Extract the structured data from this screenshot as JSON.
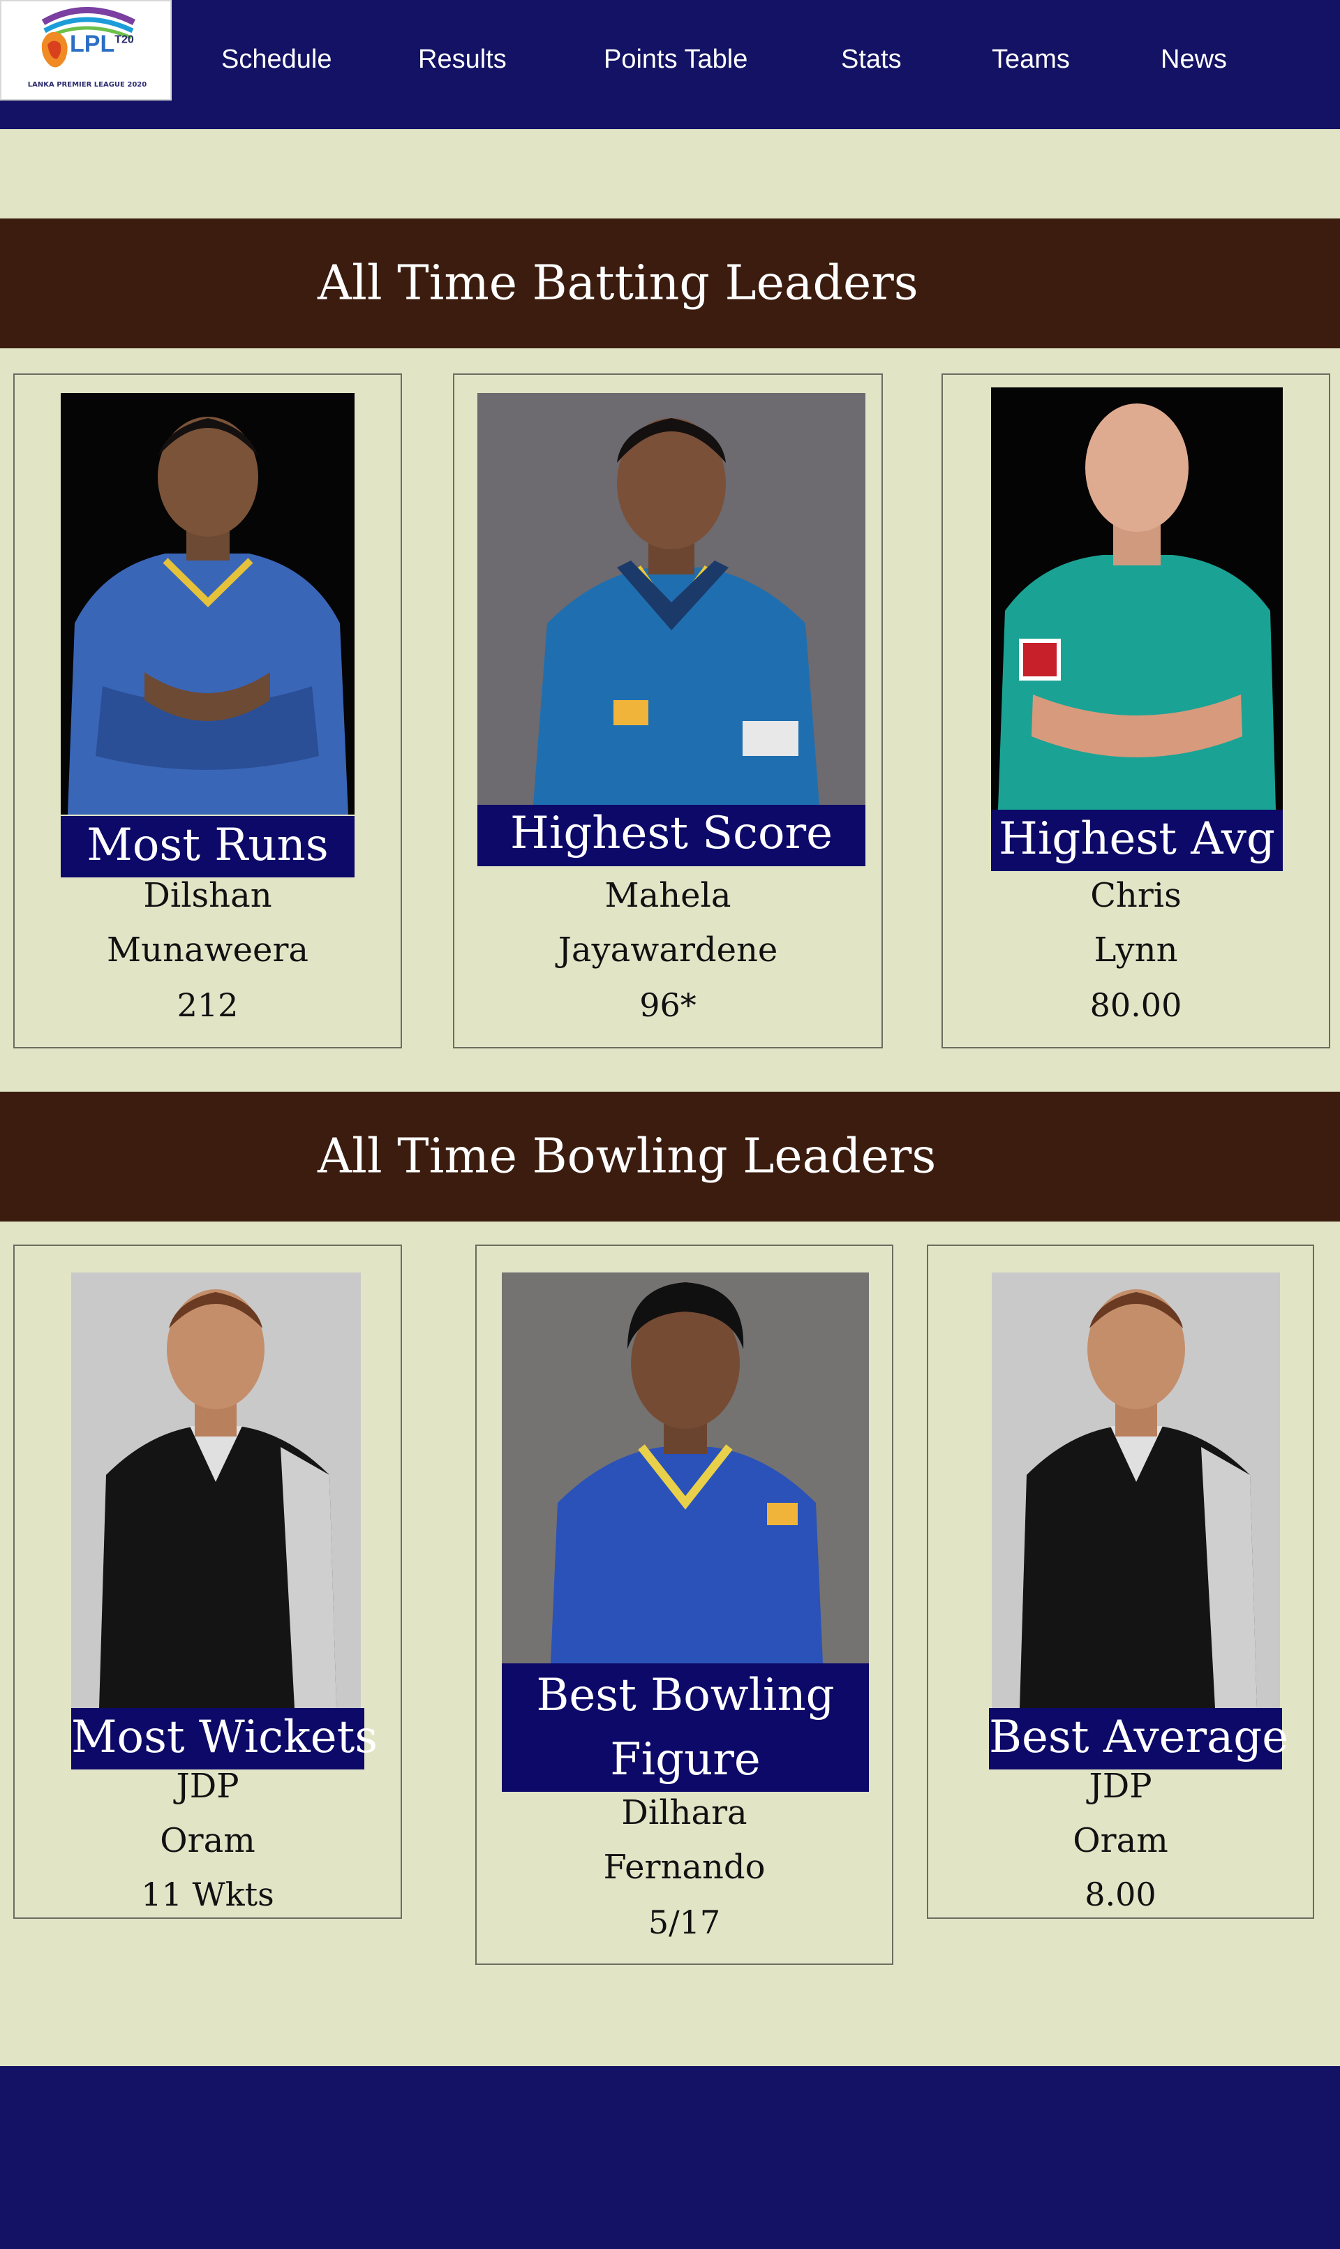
{
  "brand": {
    "logo_text": "LPL",
    "logo_superscript": "T20",
    "logo_tagline": "LANKA PREMIER LEAGUE 2020"
  },
  "nav": {
    "items": [
      "Schedule",
      "Results",
      "Points Table",
      "Stats",
      "Teams",
      "News"
    ]
  },
  "batting": {
    "title": "All Time Batting Leaders",
    "cards": [
      {
        "label": "Most Runs",
        "first_name": "Dilshan",
        "last_name": "Munaweera",
        "value": "212"
      },
      {
        "label": "Highest Score",
        "first_name": "Mahela",
        "last_name": "Jayawardene",
        "value": "96*"
      },
      {
        "label": "Highest Avg",
        "first_name": "Chris",
        "last_name": "Lynn",
        "value": "80.00"
      }
    ]
  },
  "bowling": {
    "title": "All Time Bowling Leaders",
    "cards": [
      {
        "label": "Most Wickets",
        "first_name": "JDP",
        "last_name": "Oram",
        "value": "11 Wkts"
      },
      {
        "label_line1": "Best Bowling",
        "label_line2": "Figure",
        "first_name": "Dilhara",
        "last_name": "Fernando",
        "value": "5/17"
      },
      {
        "label": "Best Average",
        "first_name": "JDP",
        "last_name": "Oram",
        "value": "8.00"
      }
    ]
  },
  "colors": {
    "nav_bg": "#131264",
    "page_bg": "#e2e4c6",
    "section_header_bg": "#3b1c0f",
    "badge_bg": "#0d0968",
    "footer_bg": "#131264"
  }
}
